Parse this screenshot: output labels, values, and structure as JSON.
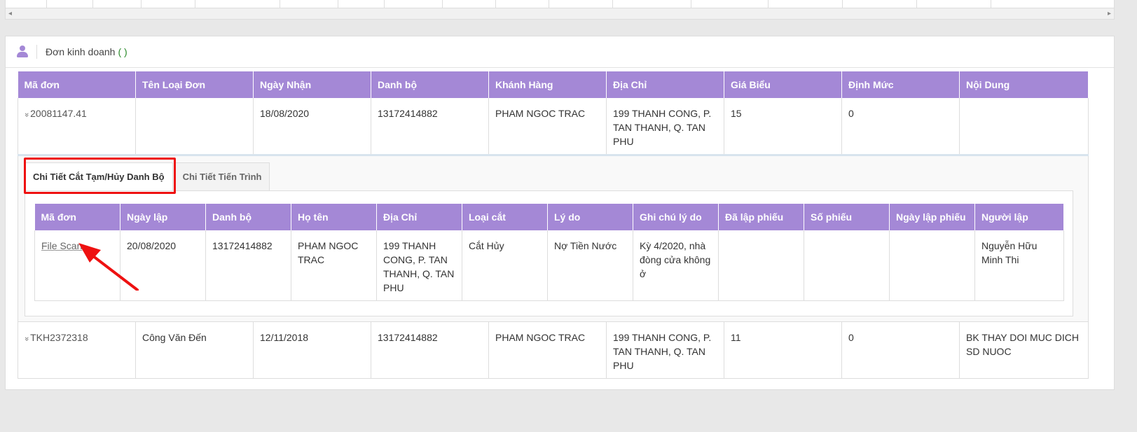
{
  "panel": {
    "title": "Đơn kinh doanh",
    "count": "( )"
  },
  "main_table": {
    "headers": [
      "Mã đơn",
      "Tên Loại Đơn",
      "Ngày Nhận",
      "Danh bộ",
      "Khánh Hàng",
      "Địa Chỉ",
      "Giá Biểu",
      "Định Mức",
      "Nội Dung"
    ],
    "rows": [
      {
        "ma_don": "20081147.41",
        "ten_loai_don": "",
        "ngay_nhan": "18/08/2020",
        "danh_bo": "13172414882",
        "khach_hang": "PHAM NGOC TRAC",
        "dia_chi": "199 THANH CONG, P. TAN THANH, Q. TAN PHU",
        "gia_bieu": "15",
        "dinh_muc": "0",
        "noi_dung": ""
      },
      {
        "ma_don": "TKH2372318",
        "ten_loai_don": "Công Văn Đến",
        "ngay_nhan": "12/11/2018",
        "danh_bo": "13172414882",
        "khach_hang": "PHAM NGOC TRAC",
        "dia_chi": "199 THANH CONG, P. TAN THANH, Q. TAN PHU",
        "gia_bieu": "11",
        "dinh_muc": "0",
        "noi_dung": "BK THAY DOI MUC DICH SD NUOC"
      }
    ]
  },
  "detail": {
    "tabs": [
      "Chi Tiết Cắt Tạm/Hủy Danh Bộ",
      "Chi Tiết Tiến Trình"
    ],
    "headers": [
      "Mã đơn",
      "Ngày lập",
      "Danh bộ",
      "Họ tên",
      "Địa Chỉ",
      "Loại cắt",
      "Lý do",
      "Ghi chú lý do",
      "Đã lập phiếu",
      "Số phiếu",
      "Ngày lập phiếu",
      "Người lập"
    ],
    "row": {
      "ma_don": "File Scan",
      "ngay_lap": "20/08/2020",
      "danh_bo": "13172414882",
      "ho_ten": "PHAM NGOC TRAC",
      "dia_chi": "199 THANH CONG, P. TAN THANH, Q. TAN PHU",
      "loai_cat": "Cắt Hủy",
      "ly_do": "Nợ Tiền Nước",
      "ghi_chu": "Kỳ 4/2020, nhà đòng cửa không ở",
      "da_lap_phieu": "",
      "so_phieu": "",
      "ngay_lap_phieu": "",
      "nguoi_lap": "Nguyễn Hữu Minh Thi"
    }
  },
  "icons": {
    "caret": "double-chevron-down-icon",
    "user": "user-icon",
    "scroll_left": "◂",
    "scroll_right": "▸",
    "caret_glyph": "»"
  },
  "colors": {
    "header_bg": "#a488d6",
    "highlight": "#e11111"
  }
}
